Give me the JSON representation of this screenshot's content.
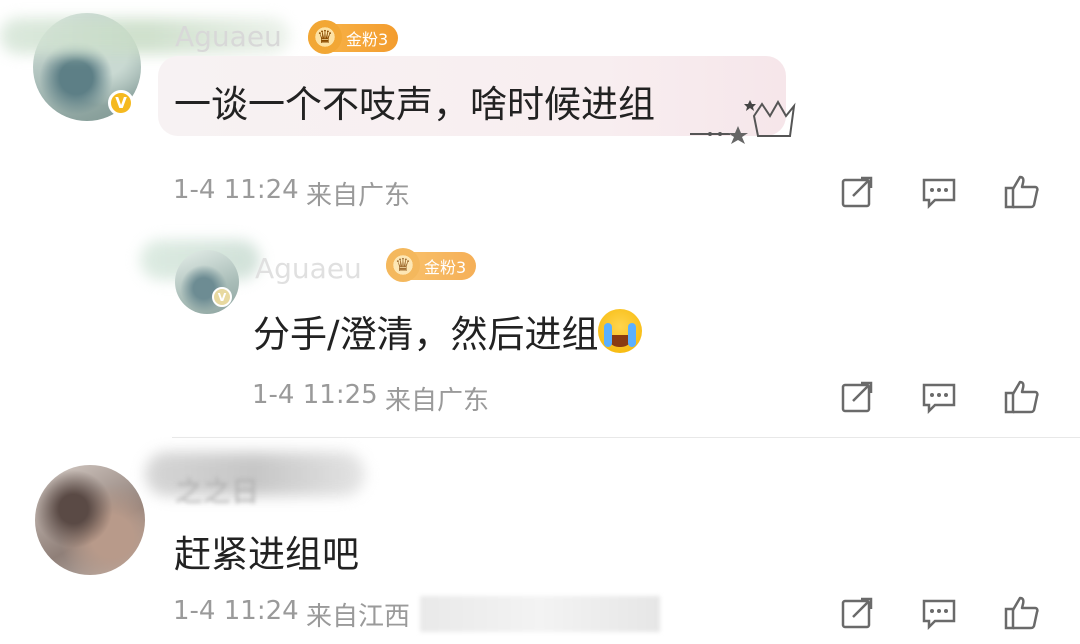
{
  "comments": [
    {
      "username": "Aguaeu",
      "fan_badge": "金粉3",
      "text": "一谈一个不吱声，啥时候进组",
      "time": "1-4 11:24",
      "location": "来自广东",
      "verified": "V"
    },
    {
      "username": "Aguaeu",
      "fan_badge": "金粉3",
      "text": "分手/澄清，然后进组",
      "emoji": "loudly-crying-face",
      "time": "1-4 11:25",
      "location": "来自广东",
      "verified": "V"
    },
    {
      "username": "之之日",
      "text": "赶紧进组吧",
      "time": "1-4 11:24",
      "location": "来自江西"
    }
  ],
  "icons": {
    "repost": "share-edit-icon",
    "comment": "comment-icon",
    "like": "thumbs-up-icon"
  },
  "colors": {
    "badge_gold": "#f39c2e",
    "verified_yellow": "#f5b920",
    "meta_gray": "#9a9a9a",
    "bubble_pink": "#f8eef0"
  }
}
